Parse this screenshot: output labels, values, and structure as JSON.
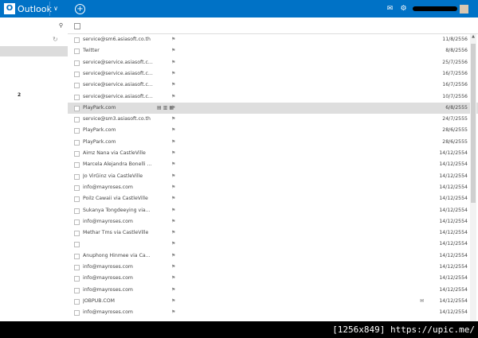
{
  "app": {
    "logo_letter": "O",
    "logo_text": "Outlook",
    "logo_chevron": "∨"
  },
  "toolbar": {
    "new_label": ""
  },
  "search": {
    "placeholder": ""
  },
  "folders": {
    "heading": "",
    "items": [
      {
        "label": "",
        "count": ""
      },
      {
        "label": "",
        "count": ""
      },
      {
        "label": "",
        "count": ""
      },
      {
        "label": "",
        "count": ""
      },
      {
        "label": "",
        "count": "2"
      }
    ],
    "create_label": ""
  },
  "quick_views": {
    "heading": "",
    "items": [
      "",
      "",
      ""
    ],
    "new_label": ""
  },
  "list_header": {
    "view_label": "",
    "sort_label": ""
  },
  "messages": [
    {
      "from": "service@sm6.asiasoft.co.th",
      "subject": "",
      "date": "11/8/2556"
    },
    {
      "from": "Twitter",
      "subject": "",
      "date": "8/8/2556"
    },
    {
      "from": "service@service.asiasoft.c...",
      "subject": "",
      "date": "25/7/2556"
    },
    {
      "from": "service@service.asiasoft.c...",
      "subject": "",
      "date": "16/7/2556"
    },
    {
      "from": "service@service.asiasoft.c...",
      "subject": "",
      "date": "16/7/2556"
    },
    {
      "from": "service@service.asiasoft.c...",
      "subject": "",
      "date": "10/7/2556"
    },
    {
      "from": "PlayPark.com",
      "subject": "",
      "date": "6/8/2555"
    },
    {
      "from": "service@sm3.asiasoft.co.th",
      "subject": "",
      "date": "24/7/2555"
    },
    {
      "from": "PlayPark.com",
      "subject": "",
      "date": "28/6/2555"
    },
    {
      "from": "PlayPark.com",
      "subject": "",
      "date": "28/6/2555"
    },
    {
      "from": "Aimz Nana via CastleVille",
      "subject": "",
      "date": "14/12/2554"
    },
    {
      "from": "Marcela Alejandra Bonelli ...",
      "subject": "",
      "date": "14/12/2554"
    },
    {
      "from": "Jo VirGinz via CastleVille",
      "subject": "",
      "date": "14/12/2554"
    },
    {
      "from": "info@mayroses.com",
      "subject": "",
      "date": "14/12/2554"
    },
    {
      "from": "Poilz Cawaii via CastleVille",
      "subject": "",
      "date": "14/12/2554"
    },
    {
      "from": "Sukanya Tongdeeying via...",
      "subject": "",
      "date": "14/12/2554"
    },
    {
      "from": "info@mayroses.com",
      "subject": "",
      "date": "14/12/2554"
    },
    {
      "from": "Methar Tms via CastleVille",
      "subject": "",
      "date": "14/12/2554"
    },
    {
      "from": "",
      "subject": "",
      "date": "14/12/2554"
    },
    {
      "from": "Anuphong Hinmee via Ca...",
      "subject": "",
      "date": "14/12/2554"
    },
    {
      "from": "info@mayroses.com",
      "subject": "",
      "date": "14/12/2554"
    },
    {
      "from": "info@mayroses.com",
      "subject": "",
      "date": "14/12/2554"
    },
    {
      "from": "info@mayroses.com",
      "subject": "",
      "date": "14/12/2554"
    },
    {
      "from": "JOBPUB.COM",
      "subject": "",
      "date": "14/12/2554"
    },
    {
      "from": "info@mayroses.com",
      "subject": "",
      "date": "14/12/2554"
    },
    {
      "from": "info@mayroses.com",
      "subject": "",
      "date": "14/12/2554"
    }
  ],
  "footer": {
    "caption": "[1256x849] https://upic.me/"
  }
}
